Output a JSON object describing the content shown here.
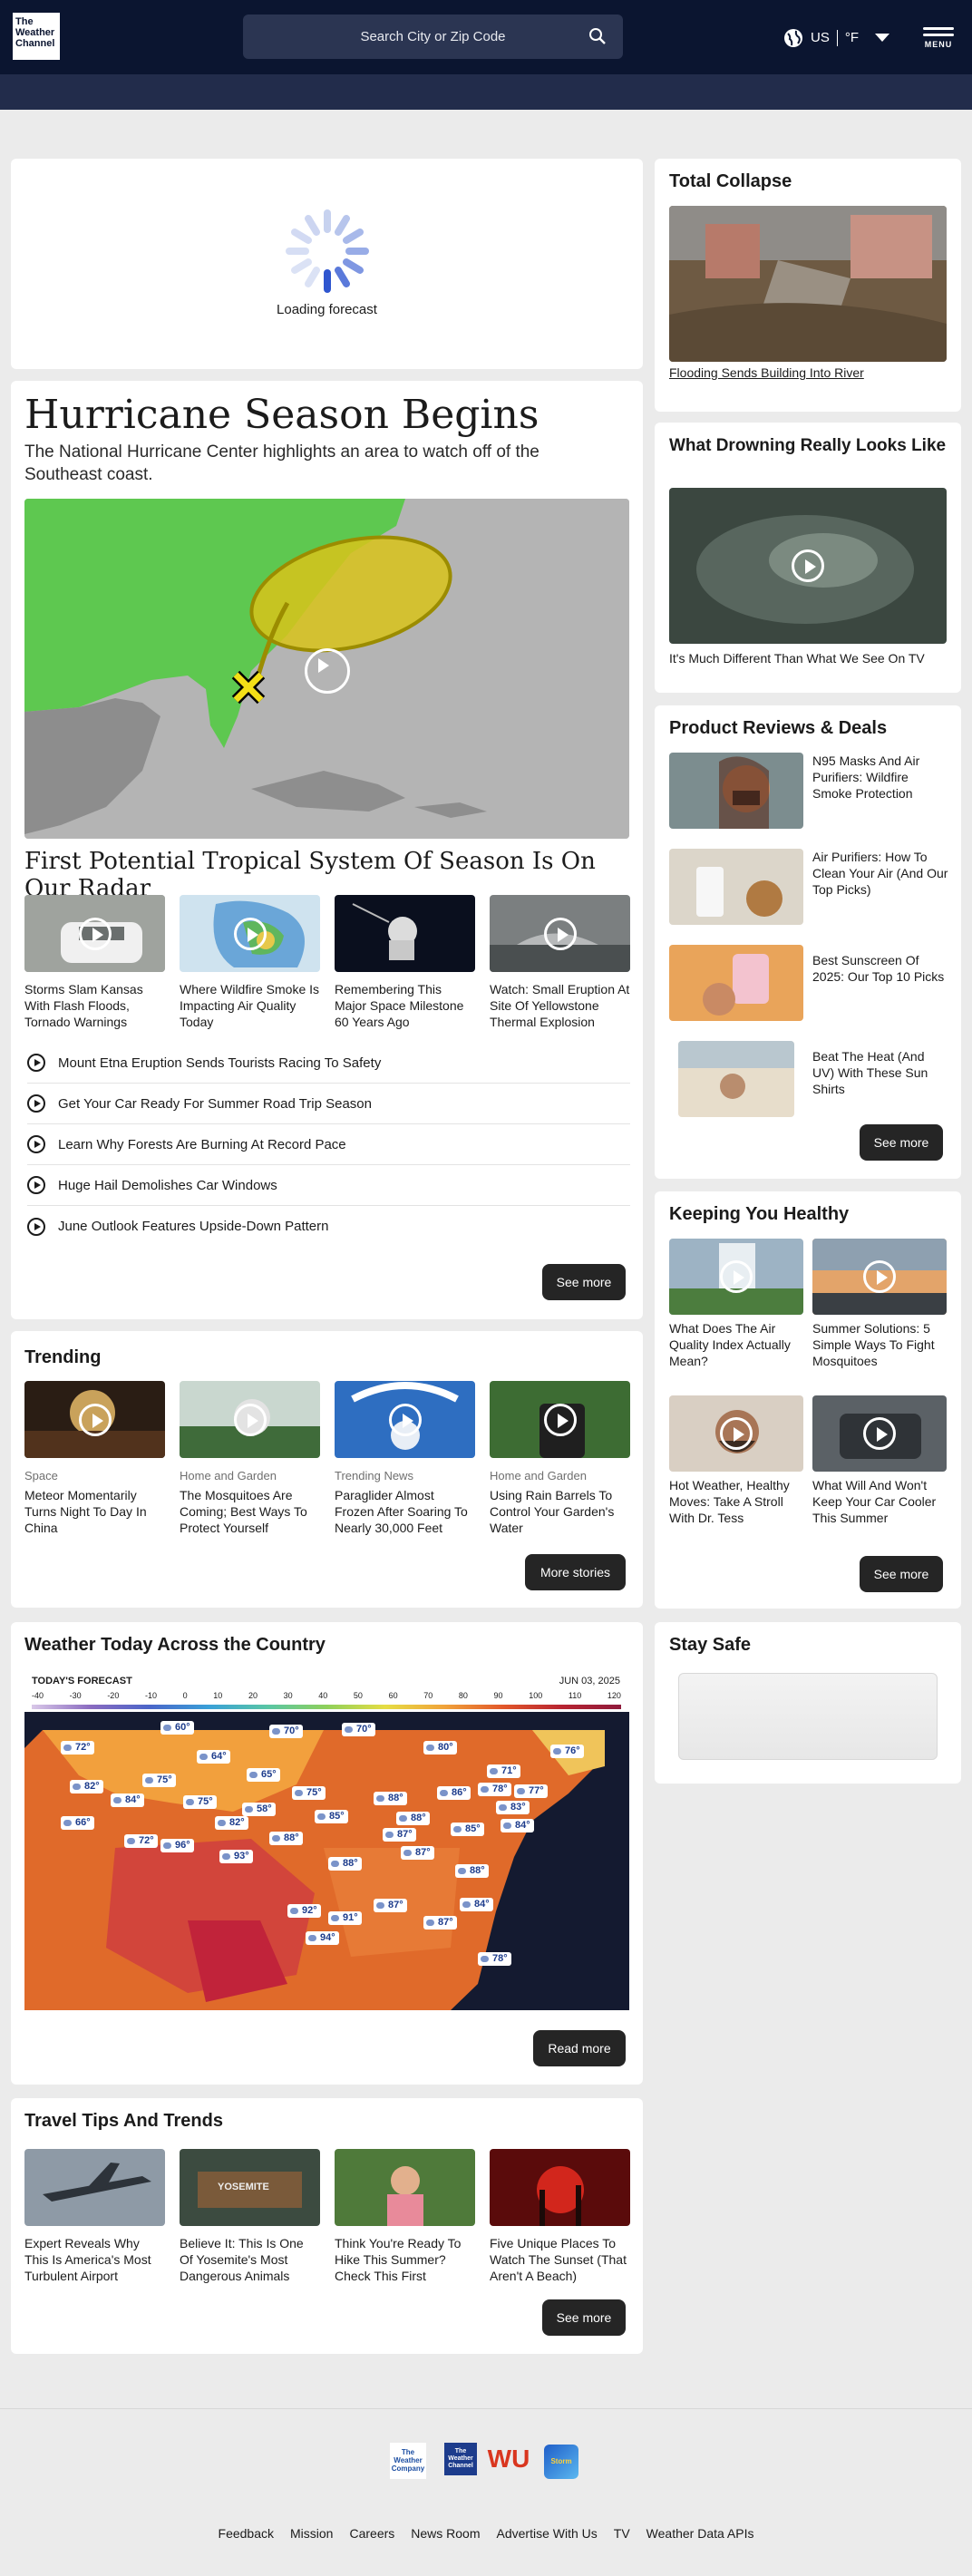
{
  "header": {
    "logo_text": "The\nWeather\nChannel",
    "search_placeholder": "Search City or Zip Code",
    "locale": "US",
    "unit": "°F",
    "menu_label": "MENU"
  },
  "forecast_loading": "Loading forecast",
  "hero": {
    "title": "Hurricane Season Begins",
    "subtitle": "The National Hurricane Center highlights an area to watch off of the Southeast coast.",
    "video_title": "First Potential Tropical System Of Season Is On Our Radar",
    "videos": [
      "Storms Slam Kansas With Flash Floods, Tornado Warnings",
      "Where Wildfire Smoke Is Impacting Air Quality Today",
      "Remembering This Major Space Milestone 60 Years Ago",
      "Watch: Small Eruption At Site Of Yellowstone Thermal Explosion"
    ],
    "links": [
      "Mount Etna Eruption Sends Tourists Racing To Safety",
      "Get Your Car Ready For Summer Road Trip Season",
      "Learn Why Forests Are Burning At Record Pace",
      "Huge Hail Demolishes Car Windows",
      "June Outlook Features Upside-Down Pattern"
    ],
    "see_more": "See more"
  },
  "trending": {
    "title": "Trending",
    "items": [
      {
        "cat": "Space",
        "text": "Meteor Momentarily Turns Night To Day In China"
      },
      {
        "cat": "Home and Garden",
        "text": "The Mosquitoes Are Coming; Best Ways To Protect Yourself"
      },
      {
        "cat": "Trending News",
        "text": "Paraglider Almost Frozen After Soaring To Nearly 30,000 Feet"
      },
      {
        "cat": "Home and Garden",
        "text": "Using Rain Barrels To Control Your Garden's Water"
      }
    ],
    "more": "More stories"
  },
  "weather_today": {
    "title": "Weather Today Across the Country",
    "map_label": "TODAY'S FORECAST",
    "map_date": "JUN 03, 2025",
    "scale": [
      "-40",
      "-30",
      "-20",
      "-10",
      "0",
      "10",
      "20",
      "30",
      "40",
      "50",
      "60",
      "70",
      "80",
      "90",
      "100",
      "110",
      "120"
    ],
    "temps": [
      "72°",
      "60°",
      "70°",
      "70°",
      "80°",
      "64°",
      "65°",
      "76°",
      "82°",
      "75°",
      "71°",
      "84°",
      "75°",
      "58°",
      "75°",
      "88°",
      "86°",
      "78°",
      "77°",
      "66°",
      "82°",
      "85°",
      "88°",
      "83°",
      "72°",
      "96°",
      "88°",
      "87°",
      "85°",
      "84°",
      "93°",
      "88°",
      "87°",
      "88°",
      "84°",
      "92°",
      "91°",
      "87°",
      "87°",
      "94°",
      "78°"
    ],
    "read_more": "Read more"
  },
  "travel": {
    "title": "Travel Tips And Trends",
    "items": [
      "Expert Reveals Why This Is America's Most Turbulent Airport",
      "Believe It: This Is One Of Yosemite's Most Dangerous Animals",
      "Think You're Ready To Hike This Summer? Check This First",
      "Five Unique Places To Watch The Sunset (That Aren't A Beach)"
    ],
    "sign_text": "YOSEMITE",
    "see_more": "See more"
  },
  "sidebar": {
    "collapse": {
      "title": "Total Collapse",
      "caption": "Flooding Sends Building Into River"
    },
    "drowning": {
      "title": "What Drowning Really Looks Like",
      "caption": "It's Much Different Than What We See On TV"
    },
    "reviews": {
      "title": "Product Reviews & Deals",
      "items": [
        "N95 Masks And Air Purifiers: Wildfire Smoke Protection",
        "Air Purifiers: How To Clean Your Air (And Our Top Picks)",
        "Best Sunscreen Of 2025: Our Top 10 Picks",
        "Beat The Heat (And UV) With These Sun Shirts"
      ],
      "see_more": "See more"
    },
    "healthy": {
      "title": "Keeping You Healthy",
      "items": [
        "What Does The Air Quality Index Actually Mean?",
        "Summer Solutions: 5 Simple Ways To Fight Mosquitoes",
        "Hot Weather, Healthy Moves: Take A Stroll With Dr. Tess",
        "What Will And Won't Keep Your Car Cooler This Summer"
      ],
      "see_more": "See more"
    },
    "stay_safe": {
      "title": "Stay Safe"
    }
  },
  "footer": {
    "brands": [
      "The Weather Company",
      "The Weather Channel",
      "WU",
      "Storm"
    ],
    "links": [
      "Feedback",
      "Mission",
      "Careers",
      "News Room",
      "Advertise With Us",
      "TV",
      "Weather Data APIs"
    ]
  },
  "colors": {
    "header": "#0b1530",
    "subheader": "#222c4b",
    "button": "#252525",
    "page_bg": "#ebebeb"
  }
}
